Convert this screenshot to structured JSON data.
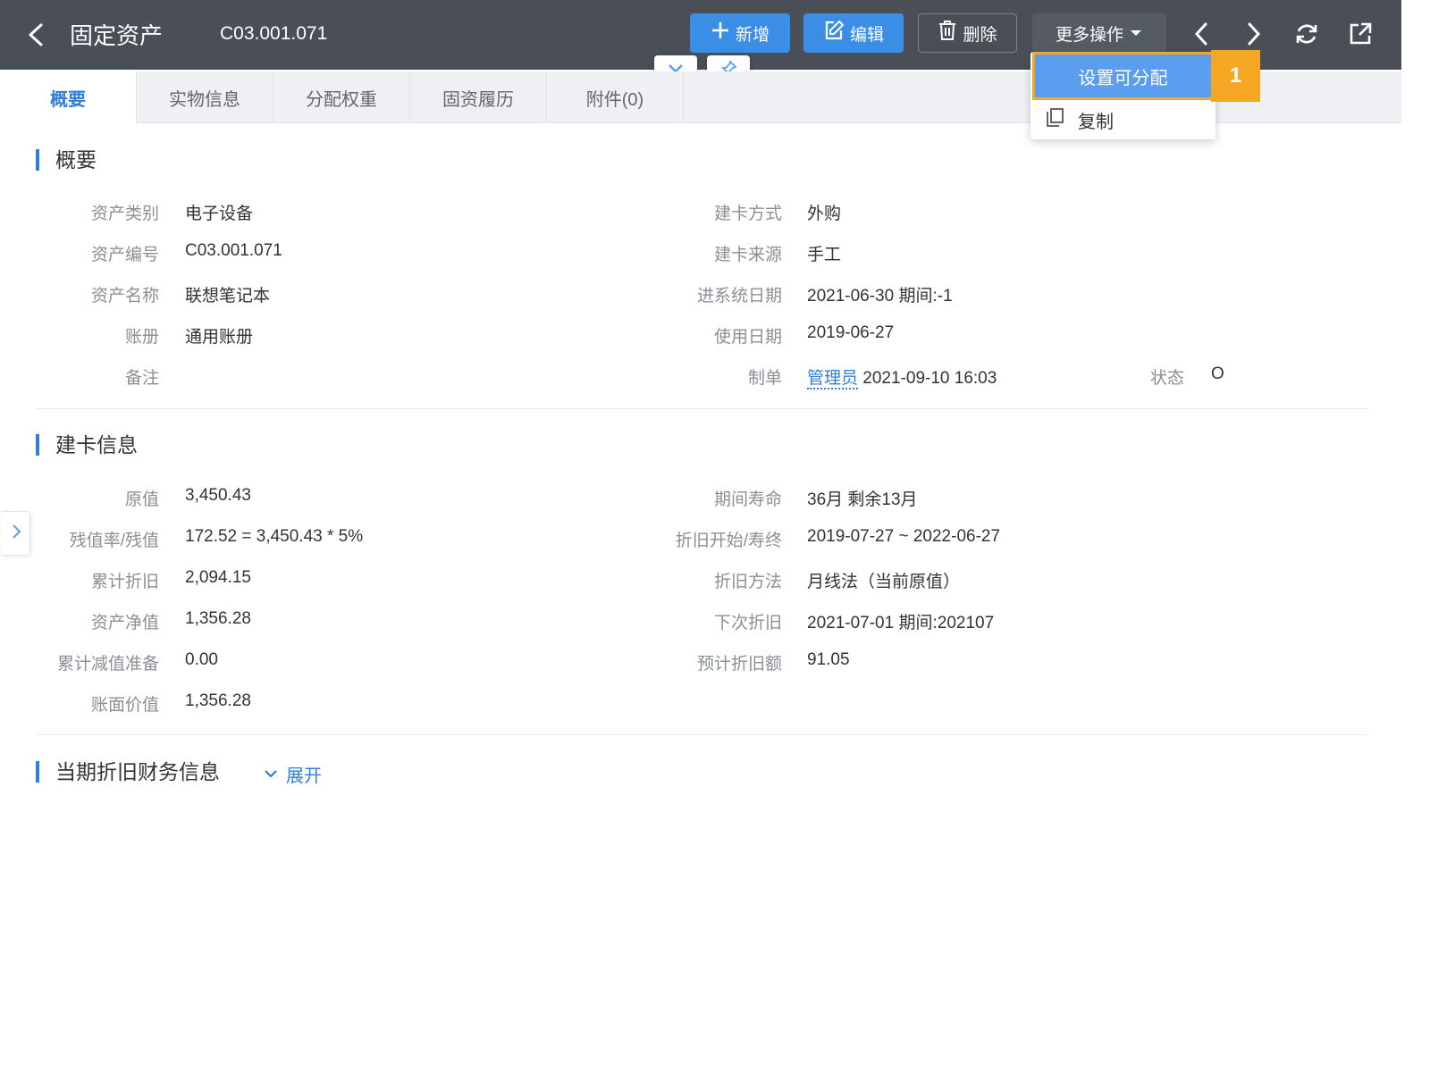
{
  "header": {
    "title": "固定资产",
    "record_code": "C03.001.071",
    "buttons": {
      "add": "新增",
      "edit": "编辑",
      "delete": "删除",
      "more": "更多操作"
    }
  },
  "dropdown": {
    "items": [
      "设置可分配",
      "复制"
    ],
    "step_badge": "1"
  },
  "tabs": [
    "概要",
    "实物信息",
    "分配权重",
    "固资履历",
    "附件(0)"
  ],
  "sections": {
    "overview": {
      "title": "概要",
      "left": [
        {
          "label": "资产类别",
          "value": "电子设备"
        },
        {
          "label": "资产编号",
          "value": "C03.001.071"
        },
        {
          "label": "资产名称",
          "value": "联想笔记本"
        },
        {
          "label": "账册",
          "value": "通用账册"
        },
        {
          "label": "备注",
          "value": ""
        }
      ],
      "right": [
        {
          "label": "建卡方式",
          "value": "外购"
        },
        {
          "label": "建卡来源",
          "value": "手工"
        },
        {
          "label": "进系统日期",
          "value": "2021-06-30 期间:-1"
        },
        {
          "label": "使用日期",
          "value": "2019-06-27"
        }
      ],
      "maker": {
        "label": "制单",
        "user": "管理员",
        "time": "2021-09-10 16:03"
      },
      "status": {
        "label": "状态",
        "value": "O"
      }
    },
    "card": {
      "title": "建卡信息",
      "left": [
        {
          "label": "原值",
          "value": "3,450.43"
        },
        {
          "label": "残值率/残值",
          "value": "172.52 = 3,450.43 * 5%"
        },
        {
          "label": "累计折旧",
          "value": "2,094.15"
        },
        {
          "label": "资产净值",
          "value": "1,356.28"
        },
        {
          "label": "累计减值准备",
          "value": "0.00"
        },
        {
          "label": "账面价值",
          "value": "1,356.28"
        }
      ],
      "right": [
        {
          "label": "期间寿命",
          "value": "36月 剩余13月"
        },
        {
          "label": "折旧开始/寿终",
          "value": "2019-07-27 ~ 2022-06-27"
        },
        {
          "label": "折旧方法",
          "value": "月线法（当前原值）"
        },
        {
          "label": "下次折旧",
          "value": "2021-07-01 期间:202107"
        },
        {
          "label": "预计折旧额",
          "value": "91.05"
        }
      ]
    },
    "depreciation": {
      "title": "当期折旧财务信息",
      "expand_label": "展开"
    }
  },
  "colors": {
    "topbar": "#4a4f57",
    "primary": "#3a8ee6",
    "accent": "#2f7fd6",
    "highlight": "#f5a623"
  }
}
